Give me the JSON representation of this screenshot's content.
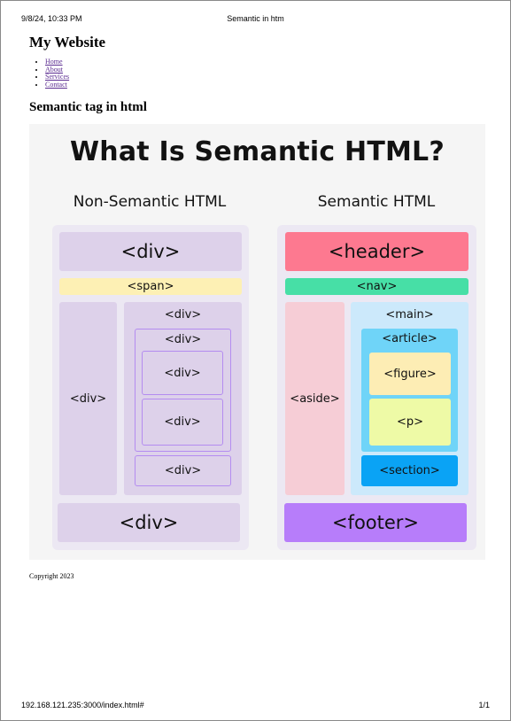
{
  "print_header": {
    "datetime": "9/8/24, 10:33 PM",
    "title": "Semantic in htm"
  },
  "print_footer": {
    "url": "192.168.121.235:3000/index.html#",
    "page": "1/1"
  },
  "site": {
    "title": "My Website",
    "nav": [
      "Home",
      "About",
      "Services",
      "Contact"
    ]
  },
  "section": {
    "title": "Semantic tag in html"
  },
  "figure": {
    "title": "What Is Semantic HTML?",
    "non_semantic": {
      "heading": "Non-Semantic HTML",
      "header": "<div>",
      "nav": "<span>",
      "aside": "<div>",
      "main": "<div>",
      "article": "<div>",
      "figure": "<div>",
      "p": "<div>",
      "section": "<div>",
      "footer": "<div>"
    },
    "semantic": {
      "heading": "Semantic HTML",
      "header": "<header>",
      "nav": "<nav>",
      "aside": "<aside>",
      "main": "<main>",
      "article": "<article>",
      "figure": "<figure>",
      "p": "<p>",
      "section": "<section>",
      "footer": "<footer>"
    },
    "colors": {
      "background": "#f5f5f5",
      "panel": "#ece8f3",
      "div_fill": "#ddd1ea",
      "div_border": "#b48cf0",
      "span": "#fdf0b4",
      "header": "#fd7990",
      "nav": "#47dfa6",
      "aside": "#f6cdd6",
      "main": "#cce9fb",
      "article": "#6fd4f8",
      "figure": "#fdedb4",
      "p": "#eefaa6",
      "section": "#0aa3f5",
      "footer": "#b77dfa"
    }
  },
  "copyright": "Copyright 2023"
}
